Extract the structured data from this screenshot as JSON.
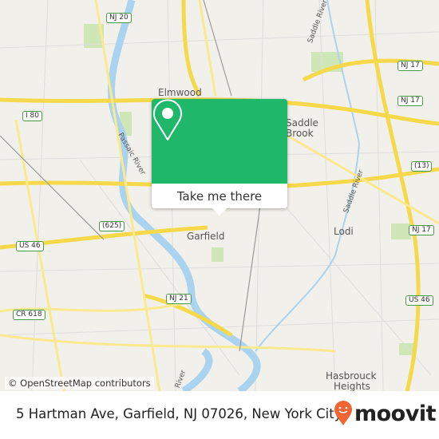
{
  "map": {
    "places": {
      "elmwood": "Elmwood",
      "saddle_brook_1": "Saddle",
      "saddle_brook_2": "Brook",
      "garfield": "Garfield",
      "lodi": "Lodi",
      "hasbrouck_1": "Hasbrouck",
      "hasbrouck_2": "Heights"
    },
    "rivers": {
      "passaic": "Passaic River",
      "saddle_1": "Saddle River",
      "saddle_2": "Saddle River",
      "river_bottom": "River"
    },
    "shields": {
      "nj20": "NJ 20",
      "nj17a": "NJ 17",
      "nj17b": "NJ 17",
      "nj17c": "NJ 17",
      "i80": "I 80",
      "r625": "(625)",
      "r13": "(13)",
      "us46a": "US 46",
      "us46b": "US 46",
      "cr618": "CR 618",
      "nj21": "NJ 21"
    },
    "attribution": "© OpenStreetMap contributors",
    "colors": {
      "land": "#f2f0ea",
      "road": "#f7e06a",
      "water": "#a9d3ee",
      "park": "#cfe6b6"
    }
  },
  "popup": {
    "icon": "location-pin-icon",
    "button_label": "Take me there",
    "color": "#1fb86b"
  },
  "footer": {
    "address": "5 Hartman Ave, Garfield, NJ 07026, New York City",
    "brand": "moovit",
    "brand_color": "#f26532"
  }
}
